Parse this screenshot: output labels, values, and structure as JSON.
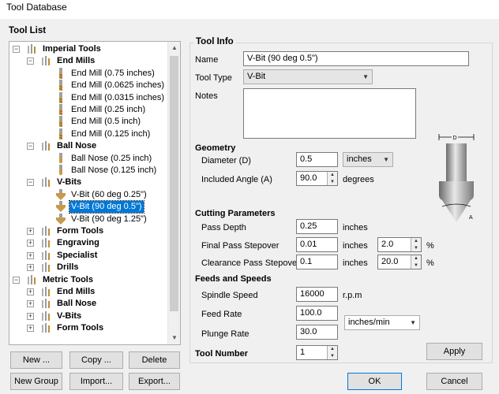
{
  "window": {
    "title": "Tool Database"
  },
  "tool_list": {
    "label": "Tool List",
    "rows": [
      {
        "text": "Imperial Tools",
        "bold": true,
        "level": 0,
        "exp": "−",
        "icon": "folder"
      },
      {
        "text": "End Mills",
        "bold": true,
        "level": 1,
        "exp": "−",
        "icon": "folder"
      },
      {
        "text": "End Mill (0.75 inches)",
        "bold": false,
        "level": 2,
        "icon": "endmill"
      },
      {
        "text": "End Mill (0.0625 inches)",
        "bold": false,
        "level": 2,
        "icon": "endmill"
      },
      {
        "text": "End Mill (0.0315 inches)",
        "bold": false,
        "level": 2,
        "icon": "endmill"
      },
      {
        "text": "End Mill (0.25 inch)",
        "bold": false,
        "level": 2,
        "icon": "endmill"
      },
      {
        "text": "End Mill (0.5 inch)",
        "bold": false,
        "level": 2,
        "icon": "endmill"
      },
      {
        "text": "End Mill (0.125 inch)",
        "bold": false,
        "level": 2,
        "icon": "endmill"
      },
      {
        "text": "Ball Nose",
        "bold": true,
        "level": 1,
        "exp": "−",
        "icon": "folder"
      },
      {
        "text": "Ball Nose (0.25 inch)",
        "bold": false,
        "level": 2,
        "icon": "ballnose"
      },
      {
        "text": "Ball Nose (0.125 inch)",
        "bold": false,
        "level": 2,
        "icon": "ballnose"
      },
      {
        "text": "V-Bits",
        "bold": true,
        "level": 1,
        "exp": "−",
        "icon": "folder"
      },
      {
        "text": "V-Bit (60 deg 0.25\")",
        "bold": false,
        "level": 2,
        "icon": "vbit"
      },
      {
        "text": "V-Bit (90 deg 0.5\")",
        "bold": false,
        "level": 2,
        "icon": "vbit",
        "selected": true
      },
      {
        "text": "V-Bit (90 deg 1.25\")",
        "bold": false,
        "level": 2,
        "icon": "vbit"
      },
      {
        "text": "Form Tools",
        "bold": true,
        "level": 1,
        "exp": "+",
        "icon": "folder"
      },
      {
        "text": "Engraving",
        "bold": true,
        "level": 1,
        "exp": "+",
        "icon": "folder"
      },
      {
        "text": "Specialist",
        "bold": true,
        "level": 1,
        "exp": "+",
        "icon": "folder"
      },
      {
        "text": "Drills",
        "bold": true,
        "level": 1,
        "exp": "+",
        "icon": "folder"
      },
      {
        "text": "Metric Tools",
        "bold": true,
        "level": 0,
        "exp": "−",
        "icon": "folder"
      },
      {
        "text": "End Mills",
        "bold": true,
        "level": 1,
        "exp": "+",
        "icon": "folder"
      },
      {
        "text": "Ball Nose",
        "bold": true,
        "level": 1,
        "exp": "+",
        "icon": "folder"
      },
      {
        "text": "V-Bits",
        "bold": true,
        "level": 1,
        "exp": "+",
        "icon": "folder"
      },
      {
        "text": "Form Tools",
        "bold": true,
        "level": 1,
        "exp": "+",
        "icon": "folder"
      }
    ],
    "buttons": {
      "new": "New ...",
      "copy": "Copy ...",
      "delete": "Delete",
      "new_group": "New Group",
      "import": "Import...",
      "export": "Export..."
    }
  },
  "tool_info": {
    "label": "Tool Info",
    "name_label": "Name",
    "name_value": "V-Bit (90 deg 0.5\")",
    "tool_type_label": "Tool Type",
    "tool_type_value": "V-Bit",
    "notes_label": "Notes",
    "notes_value": ""
  },
  "geometry": {
    "label": "Geometry",
    "diameter_label": "Diameter (D)",
    "diameter_value": "0.5",
    "diameter_unit": "inches",
    "angle_label": "Included Angle (A)",
    "angle_value": "90.0",
    "angle_unit": "degrees",
    "diagram_d": "D",
    "diagram_a": "A"
  },
  "cutting": {
    "label": "Cutting Parameters",
    "pass_depth_label": "Pass Depth",
    "pass_depth_value": "0.25",
    "pass_depth_unit": "inches",
    "final_stepover_label": "Final Pass Stepover",
    "final_stepover_value": "0.01",
    "final_stepover_unit": "inches",
    "final_stepover_pct": "2.0",
    "clearance_stepover_label": "Clearance Pass Stepover",
    "clearance_stepover_value": "0.1",
    "clearance_stepover_unit": "inches",
    "clearance_stepover_pct": "20.0",
    "pct_symbol": "%"
  },
  "feeds": {
    "label": "Feeds and Speeds",
    "spindle_label": "Spindle Speed",
    "spindle_value": "16000",
    "spindle_unit": "r.p.m",
    "feed_label": "Feed Rate",
    "feed_value": "100.0",
    "plunge_label": "Plunge Rate",
    "plunge_value": "30.0",
    "rate_unit": "inches/min"
  },
  "tool_number": {
    "label": "Tool Number",
    "value": "1"
  },
  "footer": {
    "apply": "Apply",
    "ok": "OK",
    "cancel": "Cancel"
  }
}
